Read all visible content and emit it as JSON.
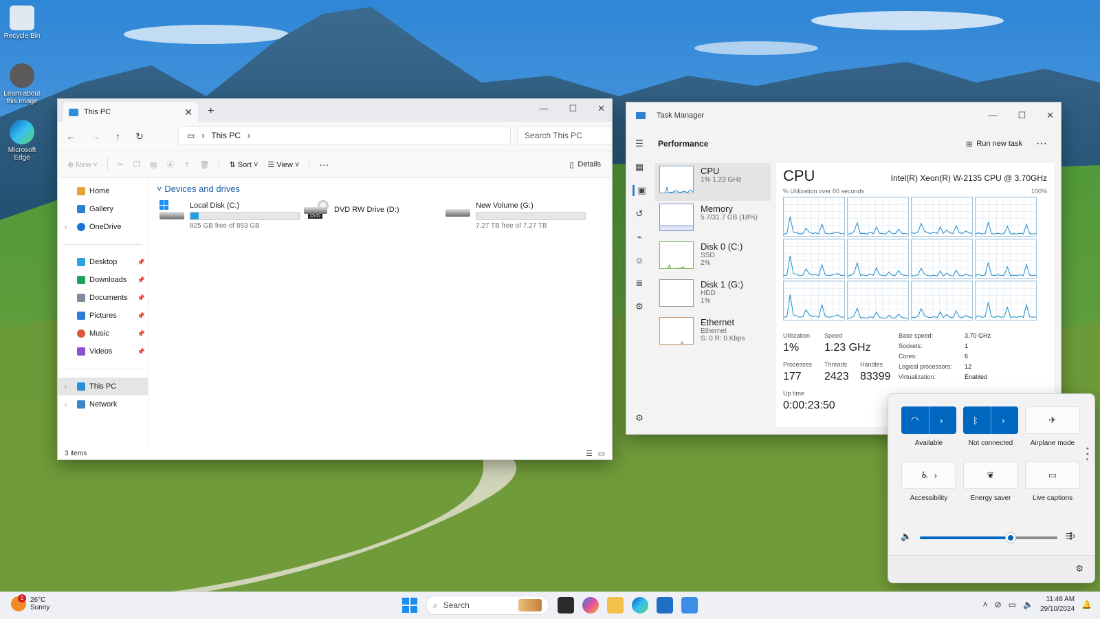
{
  "desktop": {
    "icons": [
      {
        "label": "Recycle Bin"
      },
      {
        "label": "Learn about this image"
      },
      {
        "label": "Microsoft Edge"
      }
    ]
  },
  "explorer": {
    "tab_title": "This PC",
    "breadcrumb": "This PC",
    "search_placeholder": "Search This PC",
    "toolbar": {
      "new": "New",
      "sort": "Sort",
      "view": "View",
      "details": "Details"
    },
    "sidebar": {
      "top": [
        "Home",
        "Gallery",
        "OneDrive"
      ],
      "pinned": [
        "Desktop",
        "Downloads",
        "Documents",
        "Pictures",
        "Music",
        "Videos"
      ],
      "bottom": [
        "This PC",
        "Network"
      ]
    },
    "group_header": "Devices and drives",
    "drives": [
      {
        "name": "Local Disk (C:)",
        "free": "825 GB free of 893 GB",
        "used_fraction": 0.076
      },
      {
        "name": "DVD RW Drive (D:)",
        "badge": "DVD"
      },
      {
        "name": "New Volume (G:)",
        "free": "7.27 TB free of 7.27 TB",
        "used_fraction": 0.0
      }
    ],
    "status": "3 items"
  },
  "taskmgr": {
    "title": "Task Manager",
    "section": "Performance",
    "run_new_task": "Run new task",
    "resources": [
      {
        "name": "CPU",
        "line2": "1%  1.23 GHz",
        "line3": ""
      },
      {
        "name": "Memory",
        "line2": "5.7/31.7 GB (18%)",
        "line3": ""
      },
      {
        "name": "Disk 0 (C:)",
        "line2": "SSD",
        "line3": "2%"
      },
      {
        "name": "Disk 1 (G:)",
        "line2": "HDD",
        "line3": "1%"
      },
      {
        "name": "Ethernet",
        "line2": "Ethernet",
        "line3": "S: 0  R: 0 Kbps"
      }
    ],
    "cpu": {
      "title": "CPU",
      "model": "Intel(R) Xeon(R) W-2135 CPU @ 3.70GHz",
      "util_label": "% Utilization over 60 seconds",
      "util_max": "100%",
      "stats": {
        "utilization_label": "Utilization",
        "utilization": "1%",
        "speed_label": "Speed",
        "speed": "1.23 GHz",
        "processes_label": "Processes",
        "processes": "177",
        "threads_label": "Threads",
        "threads": "2423",
        "handles_label": "Handles",
        "handles": "83399",
        "uptime_label": "Up time",
        "uptime": "0:00:23:50"
      },
      "specs": [
        {
          "k": "Base speed:",
          "v": "3.70 GHz"
        },
        {
          "k": "Sockets:",
          "v": "1"
        },
        {
          "k": "Cores:",
          "v": "6"
        },
        {
          "k": "Logical processors:",
          "v": "12"
        },
        {
          "k": "Virtualization:",
          "v": "Enabled"
        }
      ]
    }
  },
  "quick_settings": {
    "tiles": [
      {
        "label": "Available"
      },
      {
        "label": "Not connected"
      },
      {
        "label": "Airplane mode"
      },
      {
        "label": "Accessibility"
      },
      {
        "label": "Energy saver"
      },
      {
        "label": "Live captions"
      }
    ],
    "volume": 0.66
  },
  "taskbar": {
    "weather_temp": "26°C",
    "weather_desc": "Sunny",
    "weather_badge": "1",
    "search_label": "Search",
    "time": "11:48 AM",
    "date": "29/10/2024"
  },
  "colors": {
    "accent": "#0067c0",
    "drive_bar": "#26a0da",
    "cpu_graph": "#1d8bc9"
  }
}
